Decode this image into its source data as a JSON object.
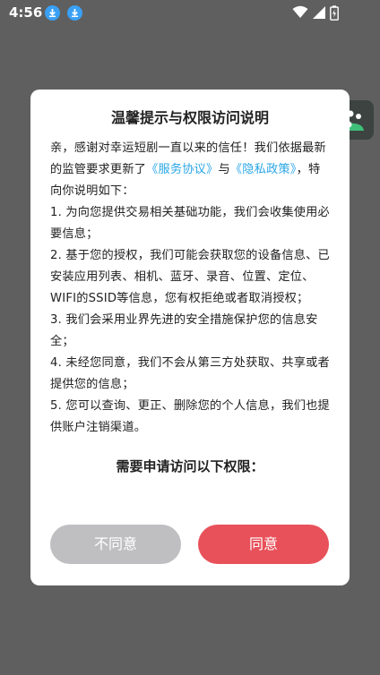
{
  "status_bar": {
    "time": "4:56",
    "icons": [
      "download-icon",
      "download-icon",
      "wifi-icon",
      "cellular-signal-icon",
      "battery-charging-icon"
    ]
  },
  "floating_button": {
    "icon": "app-assist-icon"
  },
  "dialog": {
    "title": "温馨提示与权限访问说明",
    "intro_before_links": "亲，感谢对幸运短剧一直以来的信任！我们依据最新的监管要求更新了",
    "link_service": "《服务协议》",
    "connector": "与",
    "link_privacy": "《隐私政策》",
    "intro_after_links": "，特向你说明如下：",
    "items": [
      "1. 为向您提供交易相关基础功能，我们会收集使用必要信息；",
      "2. 基于您的授权，我们可能会获取您的设备信息、已安装应用列表、相机、蓝牙、录音、位置、定位、WIFI的SSID等信息，您有权拒绝或者取消授权；",
      "3. 我们会采用业界先进的安全措施保护您的信息安全；",
      "4. 未经您同意，我们不会从第三方处获取、共享或者提供您的信息；",
      "5. 您可以查询、更正、删除您的个人信息，我们也提供账户注销渠道。"
    ],
    "permissions_heading": "需要申请访问以下权限：",
    "decline_label": "不同意",
    "agree_label": "同意"
  },
  "colors": {
    "link": "#2aa6e6",
    "agree_button": "#e8515a",
    "decline_button": "#bfbfc2",
    "backdrop": "#5f5f5f"
  }
}
